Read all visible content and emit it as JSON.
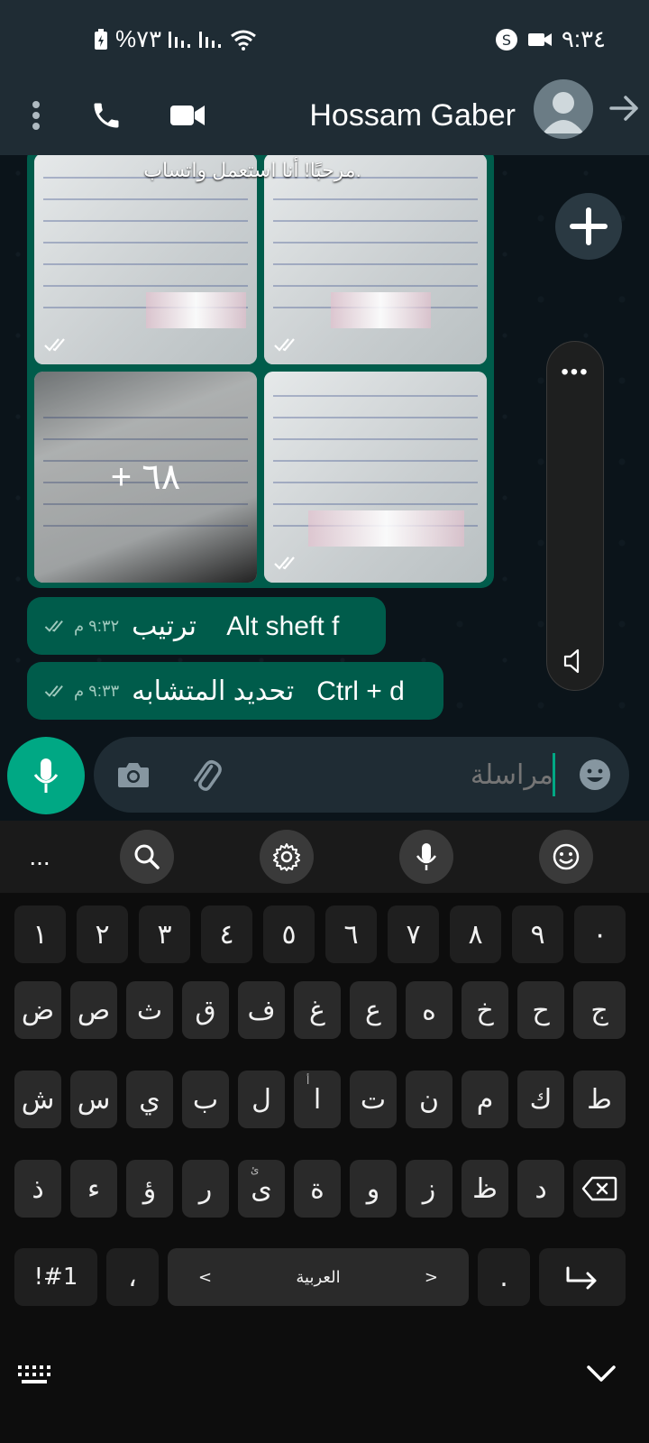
{
  "status_bar": {
    "battery": "%٧٣",
    "time": "٩:٣٤"
  },
  "header": {
    "contact_name": "Hossam Gaber"
  },
  "chat": {
    "greeting_overlay": "مرحبًا! أنا استعمل واتساب.",
    "more_count": "+ ٦٨",
    "messages": [
      {
        "text": "ترتيب    Alt sheft f",
        "time": "٩:٣٢ م"
      },
      {
        "text": "تحديد المتشابه   Ctrl + d",
        "time": "٩:٣٣ م"
      }
    ]
  },
  "composer": {
    "placeholder": "مراسلة"
  },
  "keyboard": {
    "toolbar_more": "...",
    "row_numbers": [
      "١",
      "٢",
      "٣",
      "٤",
      "٥",
      "٦",
      "٧",
      "٨",
      "٩",
      "٠"
    ],
    "row1": [
      "ض",
      "ص",
      "ث",
      "ق",
      "ف",
      "غ",
      "ع",
      "ه",
      "خ",
      "ح",
      "ج"
    ],
    "row2": [
      "ش",
      "س",
      "ي",
      "ب",
      "ل",
      "ا",
      "ت",
      "ن",
      "م",
      "ك",
      "ط"
    ],
    "row2_sup": "أ",
    "row3": [
      "ذ",
      "ء",
      "ؤ",
      "ر",
      "ى",
      "ة",
      "و",
      "ز",
      "ظ",
      "د"
    ],
    "row3_sup": "ئ",
    "symbols_key": "!#1",
    "comma_key": "،",
    "space_label": "العربية",
    "space_left": "<",
    "space_right": ">",
    "period_key": "."
  },
  "colors": {
    "bubble": "#005c4b",
    "accent": "#00a884",
    "header": "#1f2c34",
    "background": "#0b141a"
  }
}
